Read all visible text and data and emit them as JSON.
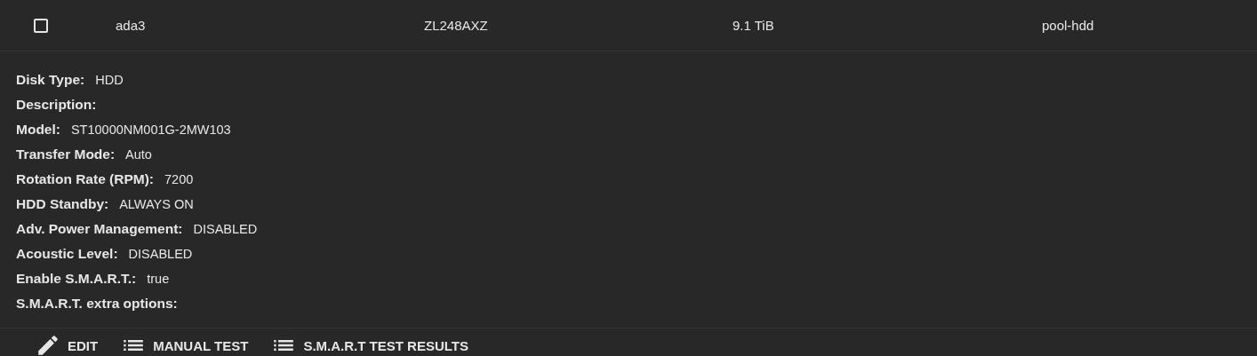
{
  "row": {
    "checked": false,
    "cells": [
      "ada3",
      "ZL248AXZ",
      "9.1 TiB",
      "pool-hdd"
    ]
  },
  "details": [
    {
      "label": "Disk Type:",
      "value": "HDD"
    },
    {
      "label": "Description:"
    },
    {
      "label": "Model:",
      "value": "ST10000NM001G-2MW103"
    },
    {
      "label": "Transfer Mode:",
      "value": "Auto"
    },
    {
      "label": "Rotation Rate (RPM):",
      "value": "7200"
    },
    {
      "label": "HDD Standby:",
      "value": "ALWAYS ON"
    },
    {
      "label": "Adv. Power Management:",
      "value": "DISABLED"
    },
    {
      "label": "Acoustic Level:",
      "value": "DISABLED"
    },
    {
      "label": "Enable S.M.A.R.T.:",
      "value": "true"
    },
    {
      "label": "S.M.A.R.T. extra options:"
    }
  ],
  "actions": [
    {
      "kind": "edit",
      "label": "EDIT"
    },
    {
      "kind": "list",
      "label": "MANUAL TEST"
    },
    {
      "kind": "list",
      "label": "S.M.A.R.T TEST RESULTS"
    }
  ]
}
